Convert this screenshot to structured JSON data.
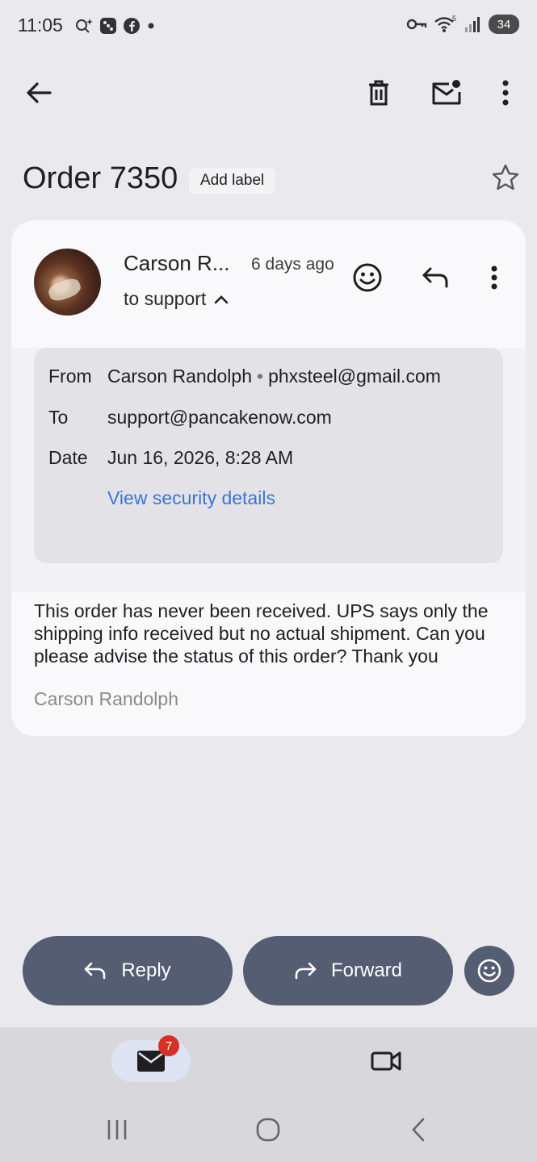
{
  "status_bar": {
    "time": "11:05",
    "battery": "34",
    "wifi_label": "5"
  },
  "toolbar": {
    "back_icon": "arrow-left-icon",
    "delete_icon": "trash-icon",
    "mark_unread_icon": "mail-unread-icon",
    "more_icon": "more-vert-icon"
  },
  "email": {
    "subject": "Order 7350",
    "add_label": "Add label",
    "sender_short": "Carson R...",
    "time_ago": "6 days ago",
    "recipient_summary": "to support",
    "details": {
      "from_label": "From",
      "from_name": "Carson Randolph",
      "from_email": "phxsteel@gmail.com",
      "to_label": "To",
      "to_value": "support@pancakenow.com",
      "date_label": "Date",
      "date_value": "Jun 16, 2026, 8:28 AM",
      "security_link": "View security details"
    },
    "body": "This order has never been received. UPS says only the shipping info received but no actual shipment. Can you please advise the status of this order? Thank you",
    "signature": "Carson Randolph"
  },
  "actions": {
    "reply_label": "Reply",
    "forward_label": "Forward"
  },
  "bottom_nav": {
    "mail_badge": "7"
  },
  "colors": {
    "background": "#e9e9ee",
    "card": "#f9f9fc",
    "action_button": "#555d72",
    "link": "#3c74d6",
    "badge": "#d93025"
  }
}
